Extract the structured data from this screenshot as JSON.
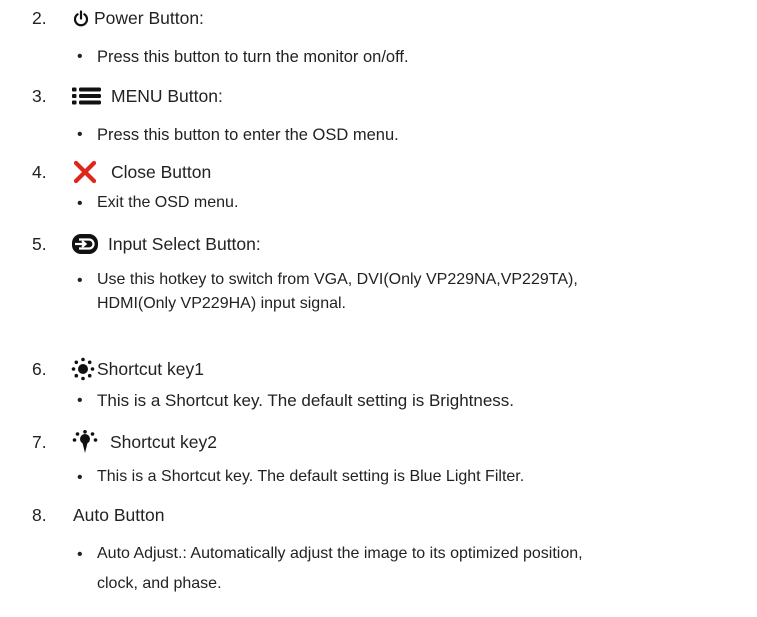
{
  "items": [
    {
      "number": "2.",
      "title": "Power Button:",
      "icon": "power-icon",
      "bullet": "Press this button to turn the monitor on/off."
    },
    {
      "number": "3.",
      "title": "MENU Button:",
      "icon": "menu-icon",
      "bullet": "Press this button to enter the OSD menu."
    },
    {
      "number": "4.",
      "title": "Close Button",
      "icon": "close-icon",
      "icon_color": "#e0251b",
      "bullet": "Exit the OSD menu."
    },
    {
      "number": "5.",
      "title": "Input Select Button:",
      "icon": "input-select-icon",
      "bullet_line1": "Use this hotkey to switch from VGA, DVI(Only VP229NA,VP229TA),",
      "bullet_line2": "HDMI(Only VP229HA) input signal."
    },
    {
      "number": "6.",
      "title": "Shortcut key1",
      "icon": "brightness-icon",
      "bullet": "This is a Shortcut key. The default setting is Brightness."
    },
    {
      "number": "7.",
      "title": "Shortcut key2",
      "icon": "blue-light-icon",
      "bullet": "This is a Shortcut key. The default setting is Blue Light Filter."
    },
    {
      "number": "8.",
      "title": "Auto Button",
      "bullet_line1": "Auto Adjust.: Automatically adjust the image to its optimized position,",
      "bullet_line2": "clock, and phase."
    }
  ]
}
